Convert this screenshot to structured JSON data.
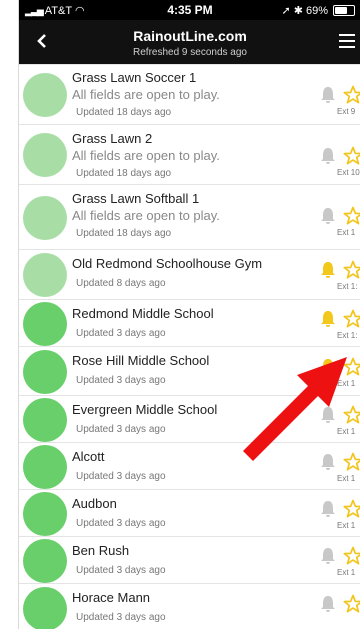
{
  "status_bar": {
    "carrier": "AT&T",
    "time": "4:35 PM",
    "battery": "69%"
  },
  "header": {
    "title": "RainoutLine.com",
    "subtitle": "Refreshed 9 seconds ago"
  },
  "colors": {
    "light_green": "#a8dea6",
    "green": "#69cf6b",
    "bell_gray": "#c8c8c8",
    "bell_gold": "#f2c81d",
    "star_gold": "#f2c51d",
    "arrow_red": "#ee1111"
  },
  "items": [
    {
      "name": "Grass Lawn Soccer 1",
      "message": "All fields are open to play.",
      "updated": "Updated 18 days ago",
      "status": "light",
      "bell": "off",
      "ext": "Ext 9"
    },
    {
      "name": "Grass Lawn 2",
      "message": "All fields are open to play.",
      "updated": "Updated 18 days ago",
      "status": "light",
      "bell": "off",
      "ext": "Ext 10"
    },
    {
      "name": "Grass Lawn Softball 1",
      "message": "All fields are open to play.",
      "updated": "Updated 18 days ago",
      "status": "light",
      "bell": "off",
      "ext": "Ext 1"
    },
    {
      "name": "Old Redmond Schoolhouse Gym",
      "message": "",
      "updated": "Updated 8 days ago",
      "status": "light",
      "bell": "on",
      "ext": "Ext 1:"
    },
    {
      "name": "Redmond Middle School",
      "message": "",
      "updated": "Updated 3 days ago",
      "status": "green",
      "bell": "on",
      "ext": "Ext 1:"
    },
    {
      "name": "Rose Hill Middle School",
      "message": "",
      "updated": "Updated 3 days ago",
      "status": "green",
      "bell": "on",
      "ext": "Ext 1"
    },
    {
      "name": "Evergreen Middle School",
      "message": "",
      "updated": "Updated 3 days ago",
      "status": "green",
      "bell": "off",
      "ext": "Ext 1"
    },
    {
      "name": "Alcott",
      "message": "",
      "updated": "Updated 3 days ago",
      "status": "green",
      "bell": "off",
      "ext": "Ext 1"
    },
    {
      "name": "Audbon",
      "message": "",
      "updated": "Updated 3 days ago",
      "status": "green",
      "bell": "off",
      "ext": "Ext 1"
    },
    {
      "name": "Ben Rush",
      "message": "",
      "updated": "Updated 3 days ago",
      "status": "green",
      "bell": "off",
      "ext": "Ext 1"
    },
    {
      "name": "Horace Mann",
      "message": "",
      "updated": "Updated 3 days ago",
      "status": "green",
      "bell": "off",
      "ext": ""
    }
  ]
}
